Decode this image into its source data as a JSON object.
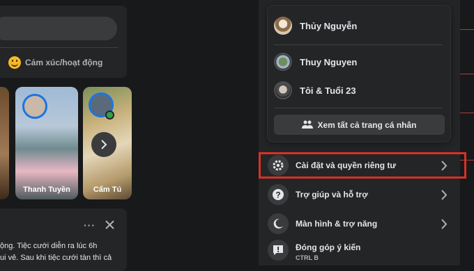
{
  "feed": {
    "feeling_label": "Cảm xúc/hoạt động",
    "stories": [
      {
        "name": "Thanh Tuyền"
      },
      {
        "name": "Cẩm Tú"
      }
    ],
    "post_text_lines": [
      "ộng. Tiệc cưới diễn ra lúc 6h",
      "ui vẻ. Sau khi tiệc cưới tàn thì cả"
    ]
  },
  "menu": {
    "profiles": [
      {
        "name": "Thủy Nguyễn"
      },
      {
        "name": "Thuy Nguyen"
      },
      {
        "name": "Tôi & Tuổi 23"
      }
    ],
    "see_all_label": "Xem tất cả trang cá nhân",
    "items": [
      {
        "label": "Cài đặt và quyền riêng tư",
        "icon": "gear-icon"
      },
      {
        "label": "Trợ giúp và hỗ trợ",
        "icon": "help-icon"
      },
      {
        "label": "Màn hình & trợ năng",
        "icon": "moon-icon"
      },
      {
        "label": "Đóng góp ý kiến",
        "shortcut": "CTRL B",
        "icon": "feedback-icon"
      }
    ]
  },
  "colors": {
    "highlight": "#d93025",
    "menu_bg": "#242526",
    "accent": "#1b74e4"
  }
}
